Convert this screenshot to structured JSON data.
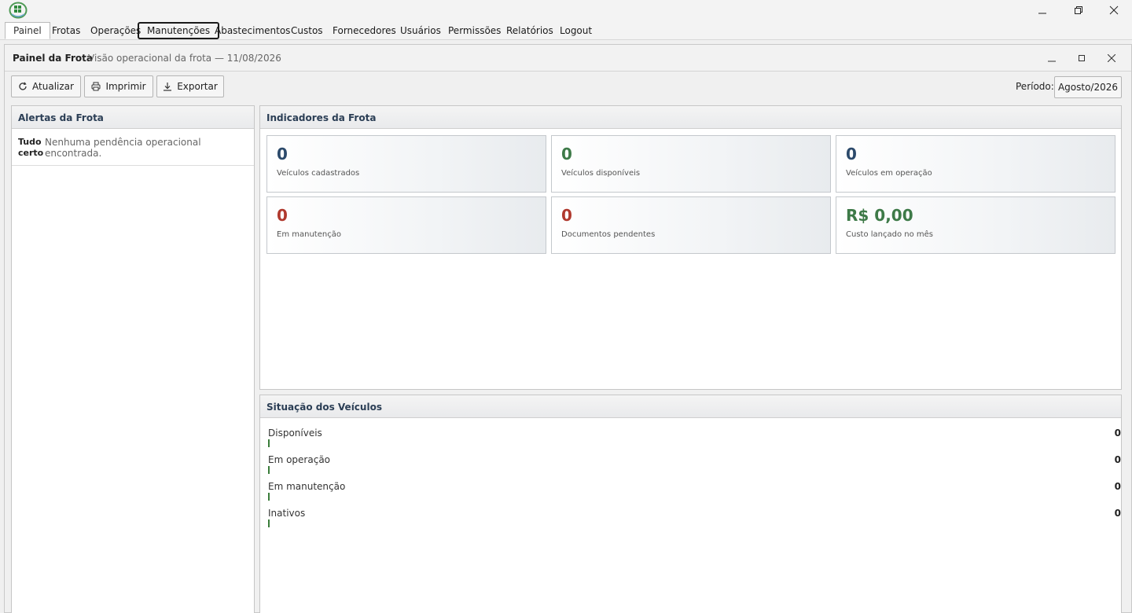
{
  "menu": {
    "items": [
      {
        "label": "Painel"
      },
      {
        "label": "Frotas"
      },
      {
        "label": "Operações"
      },
      {
        "label": "Manutenções"
      },
      {
        "label": "Abastecimentos"
      },
      {
        "label": "Custos"
      },
      {
        "label": "Fornecedores"
      },
      {
        "label": "Usuários"
      },
      {
        "label": "Permissões"
      },
      {
        "label": "Relatórios"
      },
      {
        "label": "Logout"
      }
    ],
    "active": "Painel",
    "focused": "Manutenções"
  },
  "window": {
    "title": "Painel da Frota",
    "subtitle": "Visão operacional da frota — 11/08/2026"
  },
  "toolbar": {
    "refresh_label": "Atualizar",
    "print_label": "Imprimir",
    "export_label": "Exportar",
    "period_label": "Período:",
    "period_value": "Agosto/2026"
  },
  "alerts": {
    "title": "Alertas da Frota",
    "items": [
      {
        "title": "Tudo certo",
        "text": "Nenhuma pendência operacional encontrada."
      }
    ]
  },
  "indicators": {
    "title": "Indicadores da Frota",
    "items": [
      {
        "value": "0",
        "label": "Veículos cadastrados",
        "color": "#2c4a6b"
      },
      {
        "value": "0",
        "label": "Veículos disponíveis",
        "color": "#3e7a48"
      },
      {
        "value": "0",
        "label": "Veículos em operação",
        "color": "#2c4a6b"
      },
      {
        "value": "0",
        "label": "Em manutenção",
        "color": "#b0392e"
      },
      {
        "value": "0",
        "label": "Documentos pendentes",
        "color": "#b0392e"
      },
      {
        "value": "R$ 0,00",
        "label": "Custo lançado no mês",
        "color": "#3e7a48"
      }
    ]
  },
  "vehicle_status": {
    "title": "Situação dos Veículos",
    "items": [
      {
        "label": "Disponíveis",
        "count": "0"
      },
      {
        "label": "Em operação",
        "count": "0"
      },
      {
        "label": "Em manutenção",
        "count": "0"
      },
      {
        "label": "Inativos",
        "count": "0"
      }
    ]
  },
  "colors": {
    "bar": "#3a7d3a",
    "header_text": "#2b3e55"
  }
}
